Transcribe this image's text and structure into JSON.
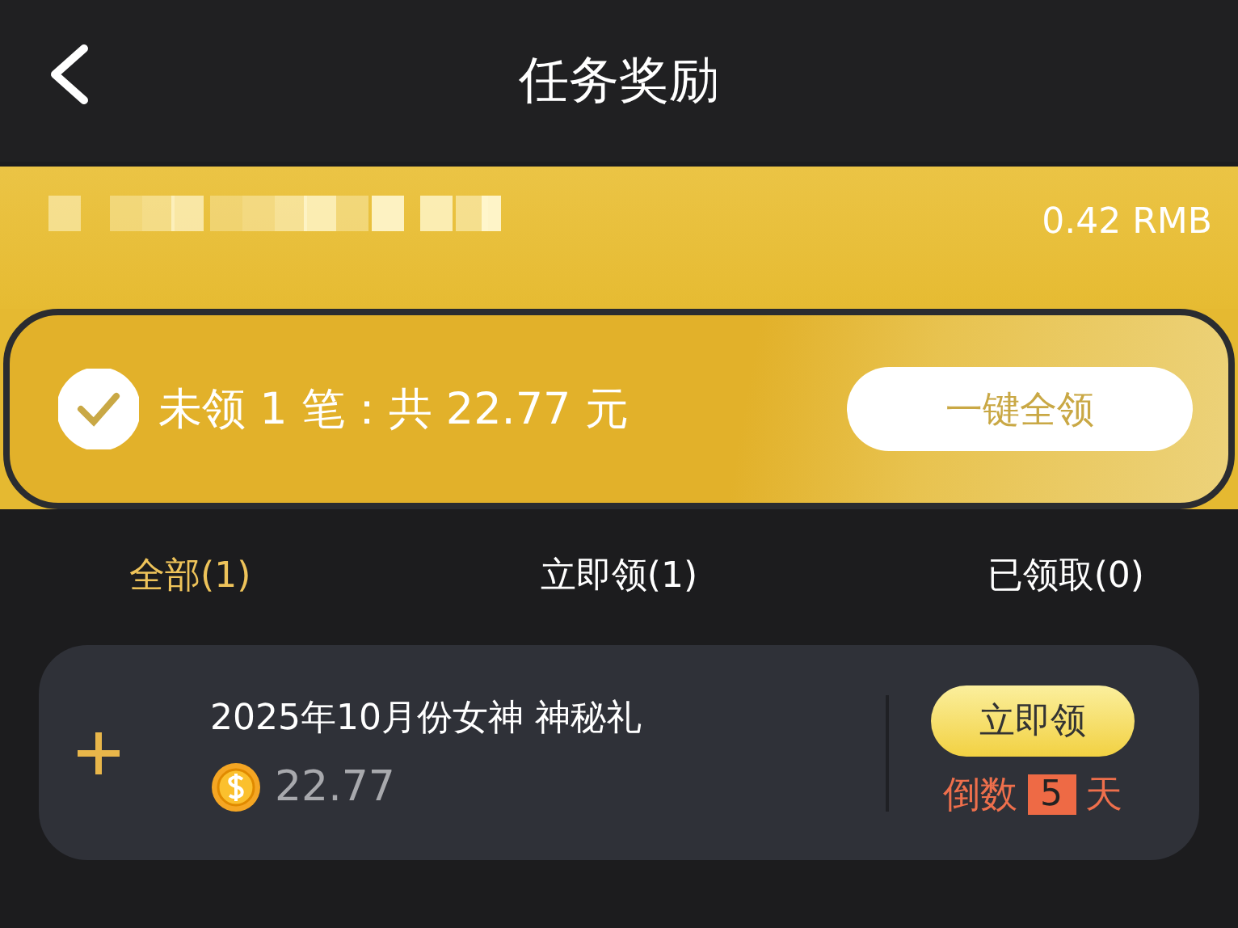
{
  "header": {
    "title": "任务奖励"
  },
  "balance": {
    "amount": "0.42 RMB"
  },
  "summary": {
    "checked": true,
    "text": "未领 1 笔：共 22.77 元",
    "button": "一键全领"
  },
  "tabs": [
    {
      "label": "全部(1)",
      "selected": true
    },
    {
      "label": "立即领(1)",
      "selected": false
    },
    {
      "label": "已领取(0)",
      "selected": false
    }
  ],
  "rewards": [
    {
      "title": "2025年10月份女神 神秘礼",
      "amount": "22.77",
      "button": "立即领",
      "countdown_prefix": "倒数",
      "countdown_days": "5",
      "countdown_suffix": "天"
    }
  ]
}
